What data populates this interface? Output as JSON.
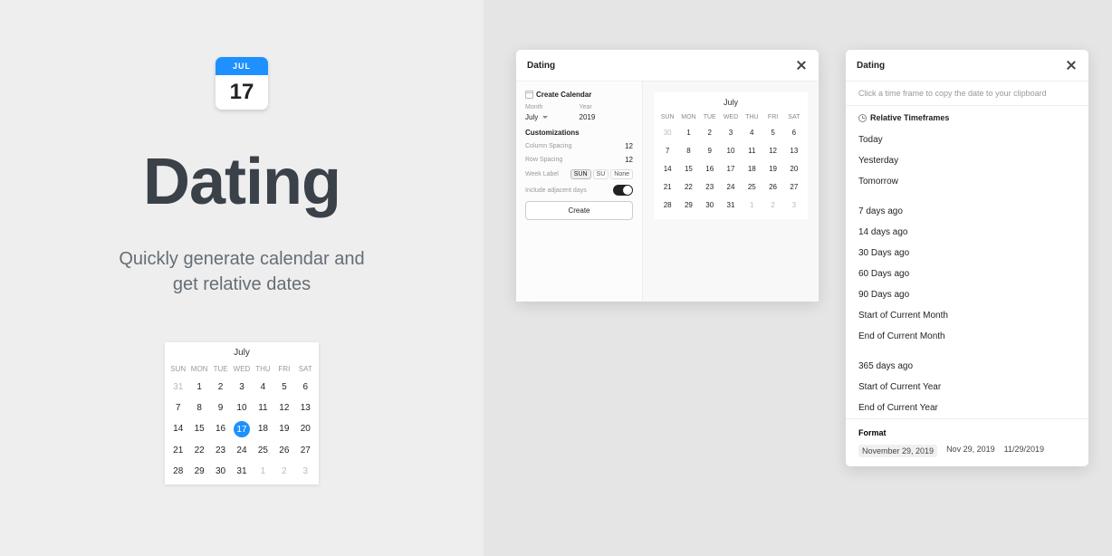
{
  "app": {
    "icon_month": "JUL",
    "icon_day": "17",
    "title": "Dating",
    "subtitle_line1": "Quickly generate calendar and",
    "subtitle_line2": "get relative dates"
  },
  "mini_calendar": {
    "title": "July",
    "week_heads": [
      "SUN",
      "MON",
      "TUE",
      "WED",
      "THU",
      "FRI",
      "SAT"
    ],
    "rows": [
      [
        {
          "d": "31",
          "adj": true
        },
        {
          "d": "1"
        },
        {
          "d": "2"
        },
        {
          "d": "3"
        },
        {
          "d": "4"
        },
        {
          "d": "5"
        },
        {
          "d": "6"
        }
      ],
      [
        {
          "d": "7"
        },
        {
          "d": "8"
        },
        {
          "d": "9"
        },
        {
          "d": "10"
        },
        {
          "d": "11"
        },
        {
          "d": "12"
        },
        {
          "d": "13"
        }
      ],
      [
        {
          "d": "14"
        },
        {
          "d": "15"
        },
        {
          "d": "16"
        },
        {
          "d": "17",
          "sel": true
        },
        {
          "d": "18"
        },
        {
          "d": "19"
        },
        {
          "d": "20"
        }
      ],
      [
        {
          "d": "21"
        },
        {
          "d": "22"
        },
        {
          "d": "23"
        },
        {
          "d": "24"
        },
        {
          "d": "25"
        },
        {
          "d": "26"
        },
        {
          "d": "27"
        }
      ],
      [
        {
          "d": "28"
        },
        {
          "d": "29"
        },
        {
          "d": "30"
        },
        {
          "d": "31"
        },
        {
          "d": "1",
          "adj": true
        },
        {
          "d": "2",
          "adj": true
        },
        {
          "d": "3",
          "adj": true
        }
      ]
    ]
  },
  "dialog1": {
    "title": "Dating",
    "section_create": "Create Calendar",
    "month_label": "Month",
    "month_value": "July",
    "year_label": "Year",
    "year_value": "2019",
    "custom_label": "Customizations",
    "col_spacing_label": "Column Spacing",
    "col_spacing_value": "12",
    "row_spacing_label": "Row Spacing",
    "row_spacing_value": "12",
    "week_label_label": "Week Label",
    "week_label_options": [
      "SUN",
      "SU",
      "None"
    ],
    "week_label_selected": "SUN",
    "include_adj_label": "Include adjacent days",
    "include_adj_value": true,
    "create_btn": "Create",
    "preview": {
      "title": "July",
      "week_heads": [
        "SUN",
        "MON",
        "TUE",
        "WED",
        "THU",
        "FRI",
        "SAT"
      ],
      "rows": [
        [
          {
            "d": "30",
            "adj": true
          },
          {
            "d": "1"
          },
          {
            "d": "2"
          },
          {
            "d": "3"
          },
          {
            "d": "4"
          },
          {
            "d": "5"
          },
          {
            "d": "6"
          }
        ],
        [
          {
            "d": "7"
          },
          {
            "d": "8"
          },
          {
            "d": "9"
          },
          {
            "d": "10"
          },
          {
            "d": "11"
          },
          {
            "d": "12"
          },
          {
            "d": "13"
          }
        ],
        [
          {
            "d": "14"
          },
          {
            "d": "15"
          },
          {
            "d": "16"
          },
          {
            "d": "17"
          },
          {
            "d": "18"
          },
          {
            "d": "19"
          },
          {
            "d": "20"
          }
        ],
        [
          {
            "d": "21"
          },
          {
            "d": "22"
          },
          {
            "d": "23"
          },
          {
            "d": "24"
          },
          {
            "d": "25"
          },
          {
            "d": "26"
          },
          {
            "d": "27"
          }
        ],
        [
          {
            "d": "28"
          },
          {
            "d": "29"
          },
          {
            "d": "30"
          },
          {
            "d": "31"
          },
          {
            "d": "1",
            "adj": true
          },
          {
            "d": "2",
            "adj": true
          },
          {
            "d": "3",
            "adj": true
          }
        ]
      ]
    }
  },
  "dialog2": {
    "title": "Dating",
    "hint": "Click a time frame to copy the date to your clipboard",
    "section_head": "Relative Timeframes",
    "groups": [
      [
        "Today",
        "Yesterday",
        "Tomorrow"
      ],
      [
        "7 days ago",
        "14 days ago",
        "30 Days ago",
        "60 Days ago",
        "90 Days ago",
        "Start of Current Month",
        "End of Current Month"
      ],
      [
        "365 days ago",
        "Start of Current Year",
        "End of Current Year"
      ]
    ],
    "format_head": "Format",
    "format_options": [
      "November 29, 2019",
      "Nov 29, 2019",
      "11/29/2019"
    ],
    "format_selected": 0
  }
}
